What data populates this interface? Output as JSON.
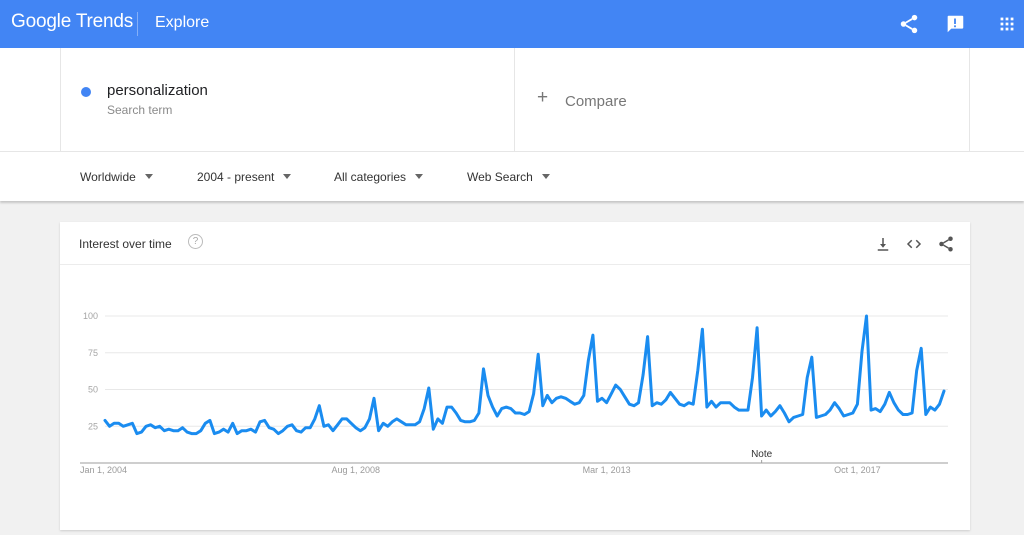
{
  "header": {
    "logo_google": "Google",
    "logo_trends": "Trends",
    "section": "Explore",
    "icons": [
      "share-icon",
      "feedback-icon",
      "apps-grid-icon"
    ]
  },
  "search": {
    "term": "personalization",
    "term_subtitle": "Search term",
    "term_color": "#4285f4",
    "compare_label": "Compare"
  },
  "filters": [
    {
      "label": "Worldwide"
    },
    {
      "label": "2004 - present"
    },
    {
      "label": "All categories"
    },
    {
      "label": "Web Search"
    }
  ],
  "card": {
    "title": "Interest over time",
    "help_icon": "?",
    "actions": [
      "download-icon",
      "embed-code-icon",
      "share-icon"
    ]
  },
  "chart_data": {
    "type": "line",
    "title": "Interest over time",
    "xlabel": "",
    "ylabel": "",
    "ylim": [
      0,
      100
    ],
    "yticks": [
      25,
      50,
      75,
      100
    ],
    "xtick_labels": [
      "Jan 1, 2004",
      "Aug 1, 2008",
      "Mar 1, 2013",
      "Oct 1, 2017"
    ],
    "x_start": "2004-01",
    "x_frequency": "monthly",
    "annotation": {
      "label": "Note",
      "date": "2016-01"
    },
    "grid": true,
    "legend": "none",
    "series": [
      {
        "name": "personalization",
        "color": "#1a8cf0",
        "values": [
          29,
          25,
          27,
          27,
          25,
          26,
          27,
          20,
          21,
          25,
          26,
          24,
          25,
          22,
          23,
          22,
          22,
          24,
          21,
          20,
          20,
          22,
          27,
          29,
          20,
          21,
          23,
          21,
          27,
          20,
          22,
          22,
          23,
          21,
          28,
          29,
          24,
          23,
          20,
          22,
          25,
          26,
          22,
          21,
          24,
          24,
          30,
          39,
          25,
          26,
          22,
          26,
          30,
          30,
          27,
          24,
          22,
          24,
          30,
          44,
          22,
          27,
          25,
          28,
          30,
          28,
          26,
          26,
          26,
          28,
          37,
          51,
          23,
          30,
          27,
          38,
          38,
          34,
          29,
          28,
          28,
          29,
          34,
          64,
          46,
          38,
          32,
          37,
          38,
          37,
          34,
          34,
          33,
          35,
          47,
          74,
          39,
          46,
          41,
          44,
          45,
          44,
          42,
          40,
          41,
          46,
          70,
          87,
          42,
          44,
          41,
          47,
          53,
          50,
          45,
          40,
          39,
          41,
          60,
          86,
          39,
          41,
          40,
          43,
          48,
          44,
          40,
          39,
          41,
          40,
          63,
          91,
          38,
          42,
          38,
          41,
          41,
          41,
          38,
          36,
          36,
          36,
          58,
          92,
          32,
          36,
          32,
          35,
          39,
          34,
          28,
          31,
          32,
          33,
          58,
          72,
          31,
          32,
          33,
          36,
          41,
          37,
          32,
          33,
          34,
          40,
          76,
          100,
          36,
          37,
          35,
          40,
          48,
          41,
          36,
          33,
          33,
          34,
          63,
          78,
          33,
          38,
          36,
          40,
          49
        ]
      }
    ]
  }
}
